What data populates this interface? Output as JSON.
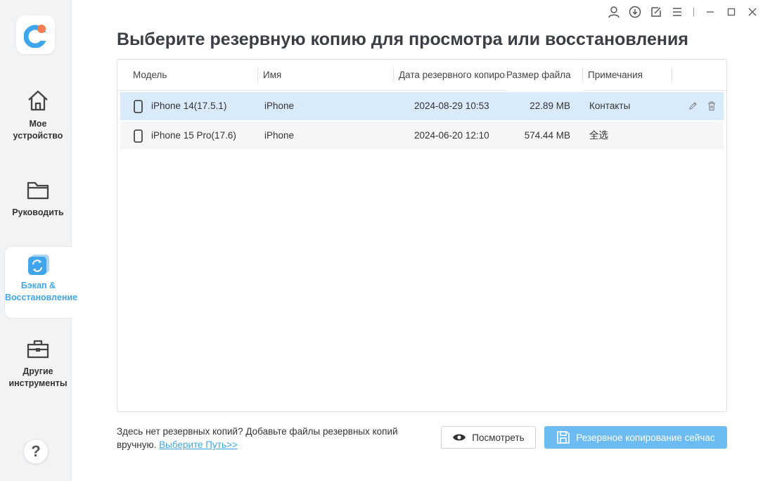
{
  "sidebar": {
    "items": [
      {
        "label": "Мое устройство",
        "icon": "home-icon"
      },
      {
        "label": "Руководить",
        "icon": "folder-icon"
      },
      {
        "label": "Бэкап & Восстановление",
        "icon": "backup-restore-icon",
        "active": true
      },
      {
        "label": "Другие инструменты",
        "icon": "toolbox-icon"
      }
    ],
    "help": "?"
  },
  "titlebar": {
    "icons": [
      "user-icon",
      "download-icon",
      "feedback-icon",
      "menu-icon",
      "minimize-icon",
      "maximize-icon",
      "close-icon"
    ]
  },
  "main": {
    "title": "Выберите резервную копию для просмотра или восстановления",
    "table": {
      "columns": [
        "Модель",
        "Имя",
        "Дата резервного копирования",
        "Размер файла",
        "Примечания"
      ],
      "rows": [
        {
          "model": "iPhone 14(17.5.1)",
          "name": "iPhone",
          "date": "2024-08-29 10:53",
          "size": "22.89 MB",
          "note": "Контакты",
          "selected": true
        },
        {
          "model": "iPhone 15 Pro(17.6)",
          "name": "iPhone",
          "date": "2024-06-20 12:10",
          "size": "574.44 MB",
          "note": "全选",
          "selected": false
        }
      ]
    }
  },
  "footer": {
    "text": "Здесь нет резервных копий? Добавьте файлы резервных копий вручную.",
    "link": "Выберите Путь>>",
    "view_button": "Посмотреть",
    "backup_button": "Резервное копирование сейчас"
  },
  "colors": {
    "accent": "#3fa6ec",
    "selected_row": "#d9ebfb",
    "backup_button": "#6cbcf3"
  }
}
